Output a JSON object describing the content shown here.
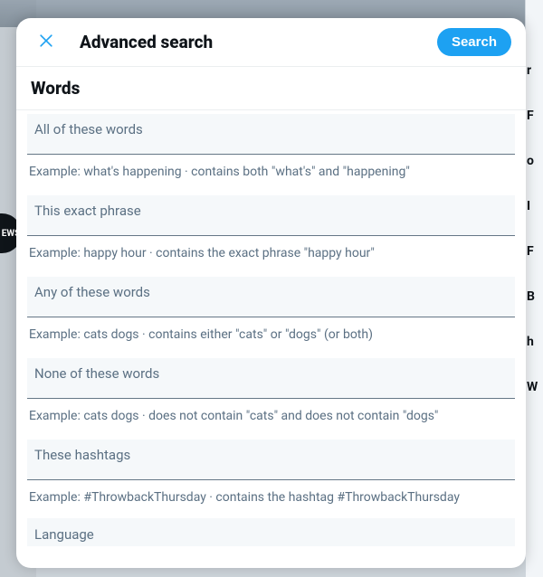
{
  "bg": {
    "badge_text": "EWS",
    "right_letters": [
      "r",
      "F",
      "o",
      "I",
      "F",
      "B",
      "h",
      "W"
    ]
  },
  "modal": {
    "title": "Advanced search",
    "search_button": "Search"
  },
  "section_heading": "Words",
  "fields": [
    {
      "label": "All of these words",
      "example": "Example: what's happening · contains both \"what's\" and \"happening\""
    },
    {
      "label": "This exact phrase",
      "example": "Example: happy hour · contains the exact phrase \"happy hour\""
    },
    {
      "label": "Any of these words",
      "example": "Example: cats dogs · contains either \"cats\" or \"dogs\" (or both)"
    },
    {
      "label": "None of these words",
      "example": "Example: cats dogs · does not contain \"cats\" and does not contain \"dogs\""
    },
    {
      "label": "These hashtags",
      "example": "Example: #ThrowbackThursday · contains the hashtag #ThrowbackThursday"
    }
  ],
  "language_label": "Language"
}
